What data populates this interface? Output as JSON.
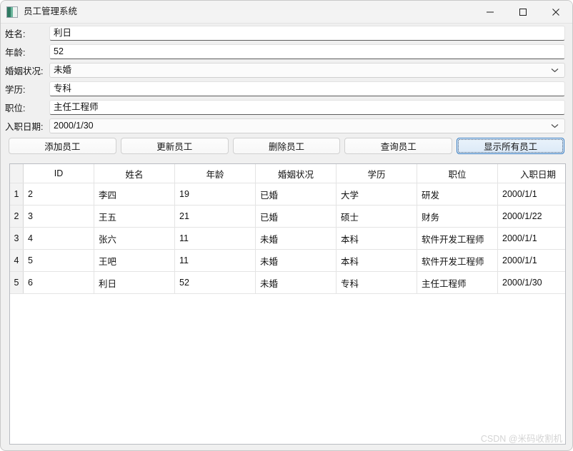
{
  "window": {
    "title": "员工管理系统",
    "icon": "app-icon",
    "controls": {
      "minimize": "minimize-icon",
      "maximize": "maximize-icon",
      "close": "close-icon"
    }
  },
  "form": {
    "fields": [
      {
        "label": "姓名:",
        "value": "利日",
        "type": "text",
        "placeholder": ""
      },
      {
        "label": "年龄:",
        "value": "52",
        "type": "text",
        "placeholder": ""
      },
      {
        "label": "婚姻状况:",
        "value": "未婚",
        "type": "combo",
        "placeholder": ""
      },
      {
        "label": "学历:",
        "value": "专科",
        "type": "text",
        "placeholder": ""
      },
      {
        "label": "职位:",
        "value": "主任工程师",
        "type": "text",
        "placeholder": ""
      },
      {
        "label": "入职日期:",
        "value": "2000/1/30",
        "type": "combo",
        "placeholder": ""
      }
    ]
  },
  "buttons": [
    {
      "label": "添加员工",
      "focused": false
    },
    {
      "label": "更新员工",
      "focused": false
    },
    {
      "label": "删除员工",
      "focused": false
    },
    {
      "label": "查询员工",
      "focused": false
    },
    {
      "label": "显示所有员工",
      "focused": true
    }
  ],
  "grid": {
    "columns": [
      "ID",
      "姓名",
      "年龄",
      "婚姻状况",
      "学历",
      "职位",
      "入职日期"
    ],
    "rows": [
      {
        "num": "1",
        "cells": [
          "2",
          "李四",
          "19",
          "已婚",
          "大学",
          "研发",
          "2000/1/1"
        ]
      },
      {
        "num": "2",
        "cells": [
          "3",
          "王五",
          "21",
          "已婚",
          "硕士",
          "财务",
          "2000/1/22"
        ]
      },
      {
        "num": "3",
        "cells": [
          "4",
          "张六",
          "11",
          "未婚",
          "本科",
          "软件开发工程师",
          "2000/1/1"
        ]
      },
      {
        "num": "4",
        "cells": [
          "5",
          "王吧",
          "11",
          "未婚",
          "本科",
          "软件开发工程师",
          "2000/1/1"
        ]
      },
      {
        "num": "5",
        "cells": [
          "6",
          "利日",
          "52",
          "未婚",
          "专科",
          "主任工程师",
          "2000/1/30"
        ]
      }
    ]
  },
  "watermark": {
    "text": "CSDN @米码收割机"
  },
  "colors": {
    "focus_border": "#3b7fc4",
    "focus_fill": "#dbe9f7",
    "titlebar_bg": "#f3f3f3",
    "window_bg": "#f0f0f0",
    "grid_line": "#e4e4e4"
  }
}
